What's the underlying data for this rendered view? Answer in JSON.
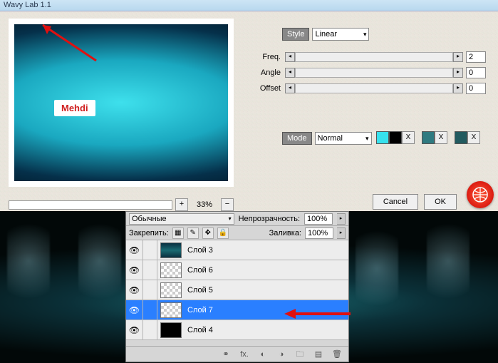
{
  "dialog": {
    "title": "Wavy Lab 1.1",
    "author_tag": "Mehdi",
    "zoom": "33%",
    "style_label": "Style",
    "style_value": "Linear",
    "mode_label": "Mode",
    "mode_value": "Normal",
    "params": {
      "freq": {
        "label": "Freq.",
        "value": "2"
      },
      "angle": {
        "label": "Angle",
        "value": "0"
      },
      "offset": {
        "label": "Offset",
        "value": "0"
      }
    },
    "swatches": {
      "c1": "#37e1ed",
      "c2": "#000000",
      "c3": "#2f7a80",
      "c4": "#225a5f",
      "x": "X"
    },
    "buttons": {
      "cancel": "Cancel",
      "ok": "OK"
    }
  },
  "layers_panel": {
    "blend_label": "Обычные",
    "opacity_label": "Непрозрачность:",
    "opacity_value": "100%",
    "lock_label": "Закрепить:",
    "fill_label": "Заливка:",
    "fill_value": "100%",
    "layers": [
      {
        "name": "Слой 3",
        "thumb": "img",
        "selected": false
      },
      {
        "name": "Слой 6",
        "thumb": "checker",
        "selected": false
      },
      {
        "name": "Слой 5",
        "thumb": "checker",
        "selected": false
      },
      {
        "name": "Слой 7",
        "thumb": "checker",
        "selected": true
      },
      {
        "name": "Слой 4",
        "thumb": "black",
        "selected": false
      }
    ]
  }
}
